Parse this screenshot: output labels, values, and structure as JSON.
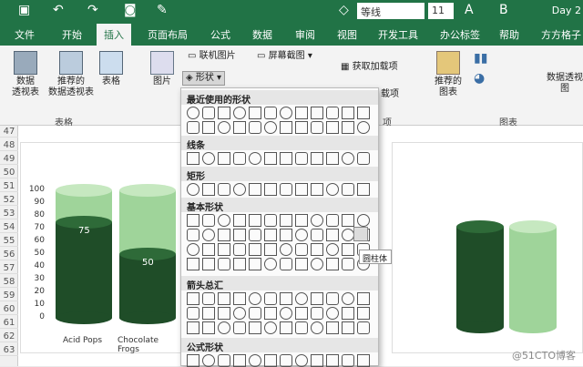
{
  "qat": {
    "font": "等线",
    "size": "11",
    "day": "Day 2"
  },
  "tabs": [
    "文件",
    "开始",
    "插入",
    "页面布局",
    "公式",
    "数据",
    "审阅",
    "视图",
    "开发工具",
    "办公标签",
    "帮助",
    "方方格子"
  ],
  "ribbon": {
    "pivot": "数据\n透视表",
    "rec_pivot": "推荐的\n数据透视表",
    "table": "表格",
    "group_table": "表格",
    "picture": "图片",
    "online_pic": "联机图片",
    "shapes": "形状",
    "screenshot": "屏幕截图",
    "addins": "获取加载项",
    "addins2": "载项",
    "rec_chart": "推荐的\n图表",
    "pivotchart": "数据透视图",
    "group_chart": "图表",
    "group_addins": "项"
  },
  "rows": [
    "47",
    "48",
    "49",
    "50",
    "51",
    "52",
    "53",
    "54",
    "55",
    "56",
    "57",
    "58",
    "59",
    "60",
    "61",
    "62",
    "63"
  ],
  "chart": {
    "axis": [
      "100",
      "90",
      "80",
      "70",
      "60",
      "50",
      "40",
      "30",
      "20",
      "10",
      "0"
    ],
    "cats": [
      "Acid Pops",
      "Chocolate Frogs"
    ],
    "labels": [
      "75",
      "50"
    ]
  },
  "chart_data": {
    "type": "bar",
    "categories": [
      "Acid Pops",
      "Chocolate Frogs"
    ],
    "values": [
      75,
      50
    ],
    "ylim": [
      0,
      100
    ]
  },
  "menu": {
    "recent": "最近使用的形状",
    "lines": "线条",
    "rect": "矩形",
    "basic": "基本形状",
    "arrows": "箭头总汇",
    "eq": "公式形状"
  },
  "tooltip": "圆柱体",
  "watermark": "@51CTO博客"
}
